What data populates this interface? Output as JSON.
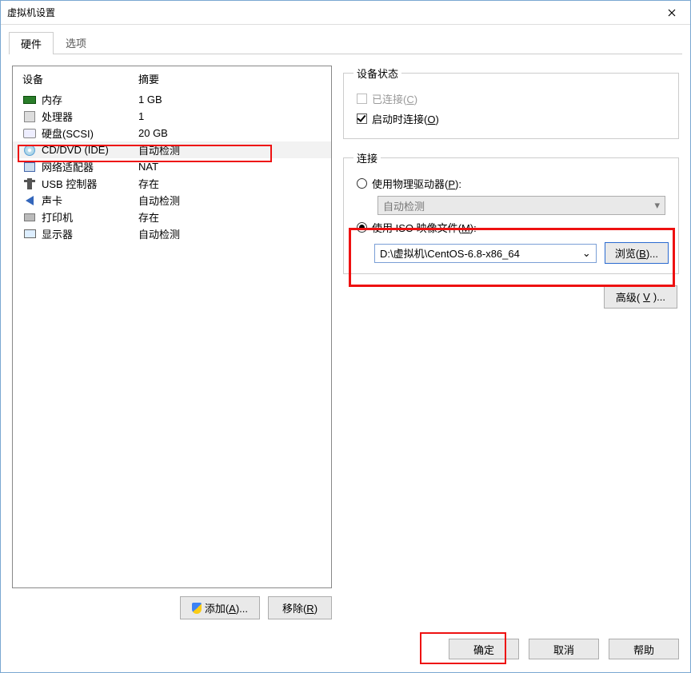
{
  "window": {
    "title": "虚拟机设置"
  },
  "tabs": {
    "hardware": "硬件",
    "options": "选项"
  },
  "list": {
    "header_device": "设备",
    "header_summary": "摘要",
    "rows": [
      {
        "name": "内存",
        "summary": "1 GB",
        "icon": "mem"
      },
      {
        "name": "处理器",
        "summary": "1",
        "icon": "cpu"
      },
      {
        "name": "硬盘(SCSI)",
        "summary": "20 GB",
        "icon": "disk"
      },
      {
        "name": "CD/DVD (IDE)",
        "summary": "自动检测",
        "icon": "cd"
      },
      {
        "name": "网络适配器",
        "summary": "NAT",
        "icon": "net"
      },
      {
        "name": "USB 控制器",
        "summary": "存在",
        "icon": "usb"
      },
      {
        "name": "声卡",
        "summary": "自动检测",
        "icon": "sound"
      },
      {
        "name": "打印机",
        "summary": "存在",
        "icon": "print"
      },
      {
        "name": "显示器",
        "summary": "自动检测",
        "icon": "display"
      }
    ]
  },
  "left_buttons": {
    "add": "添加(",
    "add_key": "A",
    "add_suffix": ")...",
    "remove": "移除(",
    "remove_key": "R",
    "remove_suffix": ")"
  },
  "status_group": {
    "legend": "设备状态",
    "connected": "已连接(",
    "connected_key": "C",
    "connected_suffix": ")",
    "connect_on_power": "启动时连接(",
    "connect_on_power_key": "O",
    "connect_on_power_suffix": ")"
  },
  "conn_group": {
    "legend": "连接",
    "use_physical": "使用物理驱动器(",
    "use_physical_key": "P",
    "use_physical_suffix": "):",
    "auto_detect": "自动检测",
    "use_iso": "使用 ISO 映像文件(",
    "use_iso_key": "M",
    "use_iso_suffix": "):",
    "iso_path": "D:\\虚拟机\\CentOS-6.8-x86_64",
    "browse": "浏览(",
    "browse_key": "B",
    "browse_suffix": ")..."
  },
  "advanced": {
    "label": "高级(",
    "key": "V",
    "suffix": ")..."
  },
  "bottom": {
    "ok": "确定",
    "cancel": "取消",
    "help": "帮助"
  }
}
